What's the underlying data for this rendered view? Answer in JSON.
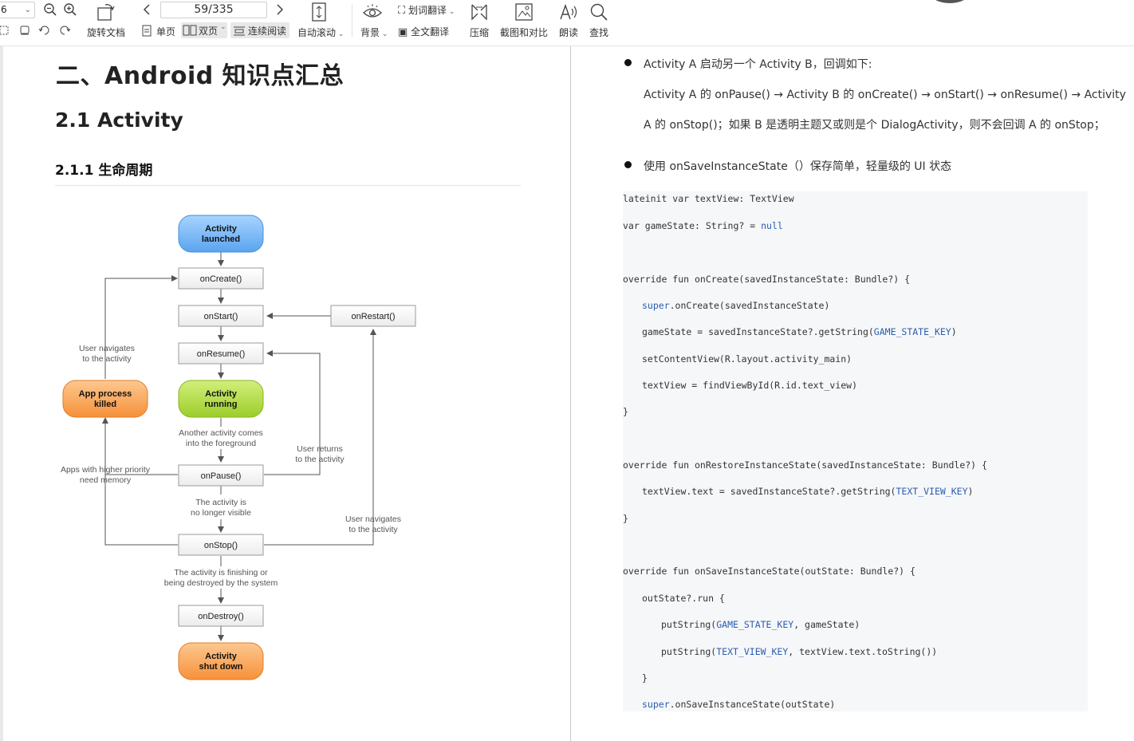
{
  "toolbar": {
    "zoom_value": "6",
    "page_indicator": "59/335",
    "rotate_label": "旋转文档",
    "single_label": "单页",
    "double_label": "双页",
    "continuous_label": "连续阅读",
    "autoscroll_label": "自动滚动",
    "background_label": "背景",
    "word_translate_label": "划词翻译",
    "full_translate_label": "全文翻译",
    "compress_label": "压缩",
    "screenshot_compare_label": "截图和对比",
    "read_aloud_label": "朗读",
    "find_label": "查找"
  },
  "left_page": {
    "h1": "二、Android 知识点汇总",
    "h2": "2.1 Activity",
    "h3": "2.1.1  生命周期",
    "diagram": {
      "nodes": {
        "launched": "Activity launched",
        "launched_l1": "Activity",
        "launched_l2": "launched",
        "oncreate": "onCreate()",
        "onstart": "onStart()",
        "onrestart": "onRestart()",
        "onresume": "onResume()",
        "running_l1": "Activity",
        "running_l2": "running",
        "killed_l1": "App process",
        "killed_l2": "killed",
        "onpause": "onPause()",
        "onstop": "onStop()",
        "ondestroy": "onDestroy()",
        "shutdown_l1": "Activity",
        "shutdown_l2": "shut down"
      },
      "labels": {
        "user_nav_1a": "User navigates",
        "user_nav_1b": "to the activity",
        "another_1": "Another activity comes",
        "another_2": "into the foreground",
        "user_returns_1": "User returns",
        "user_returns_2": "to the activity",
        "higher_1": "Apps with higher priority",
        "higher_2": "need memory",
        "no_longer_1": "The activity is",
        "no_longer_2": "no longer visible",
        "user_nav_2a": "User navigates",
        "user_nav_2b": "to the activity",
        "finishing_1": "The activity is finishing or",
        "finishing_2": "being destroyed by the system"
      }
    }
  },
  "right_page": {
    "bullet1": "Activity A  启动另一个 Activity B，回调如下:",
    "para1": "Activity A  的 onPause() → Activity B 的 onCreate() → onStart() → onResume() → Activity",
    "para2": "A 的 onStop()；如果 B 是透明主题又或则是个 DialogActivity，则不会回调 A 的 onStop；",
    "bullet2": "使用 onSaveInstanceState（）保存简单，轻量级的 UI 状态",
    "code": {
      "l1": "lateinit var textView: TextView",
      "l2a": "var gameState: String? = ",
      "l2b": "null",
      "l3": "override fun onCreate(savedInstanceState: Bundle?) {",
      "l4a": "super",
      "l4b": ".onCreate(savedInstanceState)",
      "l5a": "gameState = savedInstanceState?.getString(",
      "l5b": "GAME_STATE_KEY",
      "l5c": ")",
      "l6": "setContentView(R.layout.activity_main)",
      "l7": "textView = findViewById(R.id.text_view)",
      "l8": "}",
      "l9": "override fun onRestoreInstanceState(savedInstanceState: Bundle?) {",
      "l10a": "textView.text = savedInstanceState?.getString(",
      "l10b": "TEXT_VIEW_KEY",
      "l10c": ")",
      "l11": "}",
      "l12": "override fun onSaveInstanceState(outState: Bundle?) {",
      "l13": "outState?.run {",
      "l14a": "putString(",
      "l14b": "GAME_STATE_KEY",
      "l14c": ", gameState)",
      "l15a": "putString(",
      "l15b": "TEXT_VIEW_KEY",
      "l15c": ", textView.text.toString())",
      "l16": "}",
      "l17a": "super",
      "l17b": ".onSaveInstanceState(outState)"
    }
  },
  "colors": {
    "launched_fill": "#7fbef8",
    "running_fill": "#b6e046",
    "orange_fill": "#fbaa5e",
    "code_bg": "#f6f7f9",
    "code_blue": "#2a5db0"
  }
}
